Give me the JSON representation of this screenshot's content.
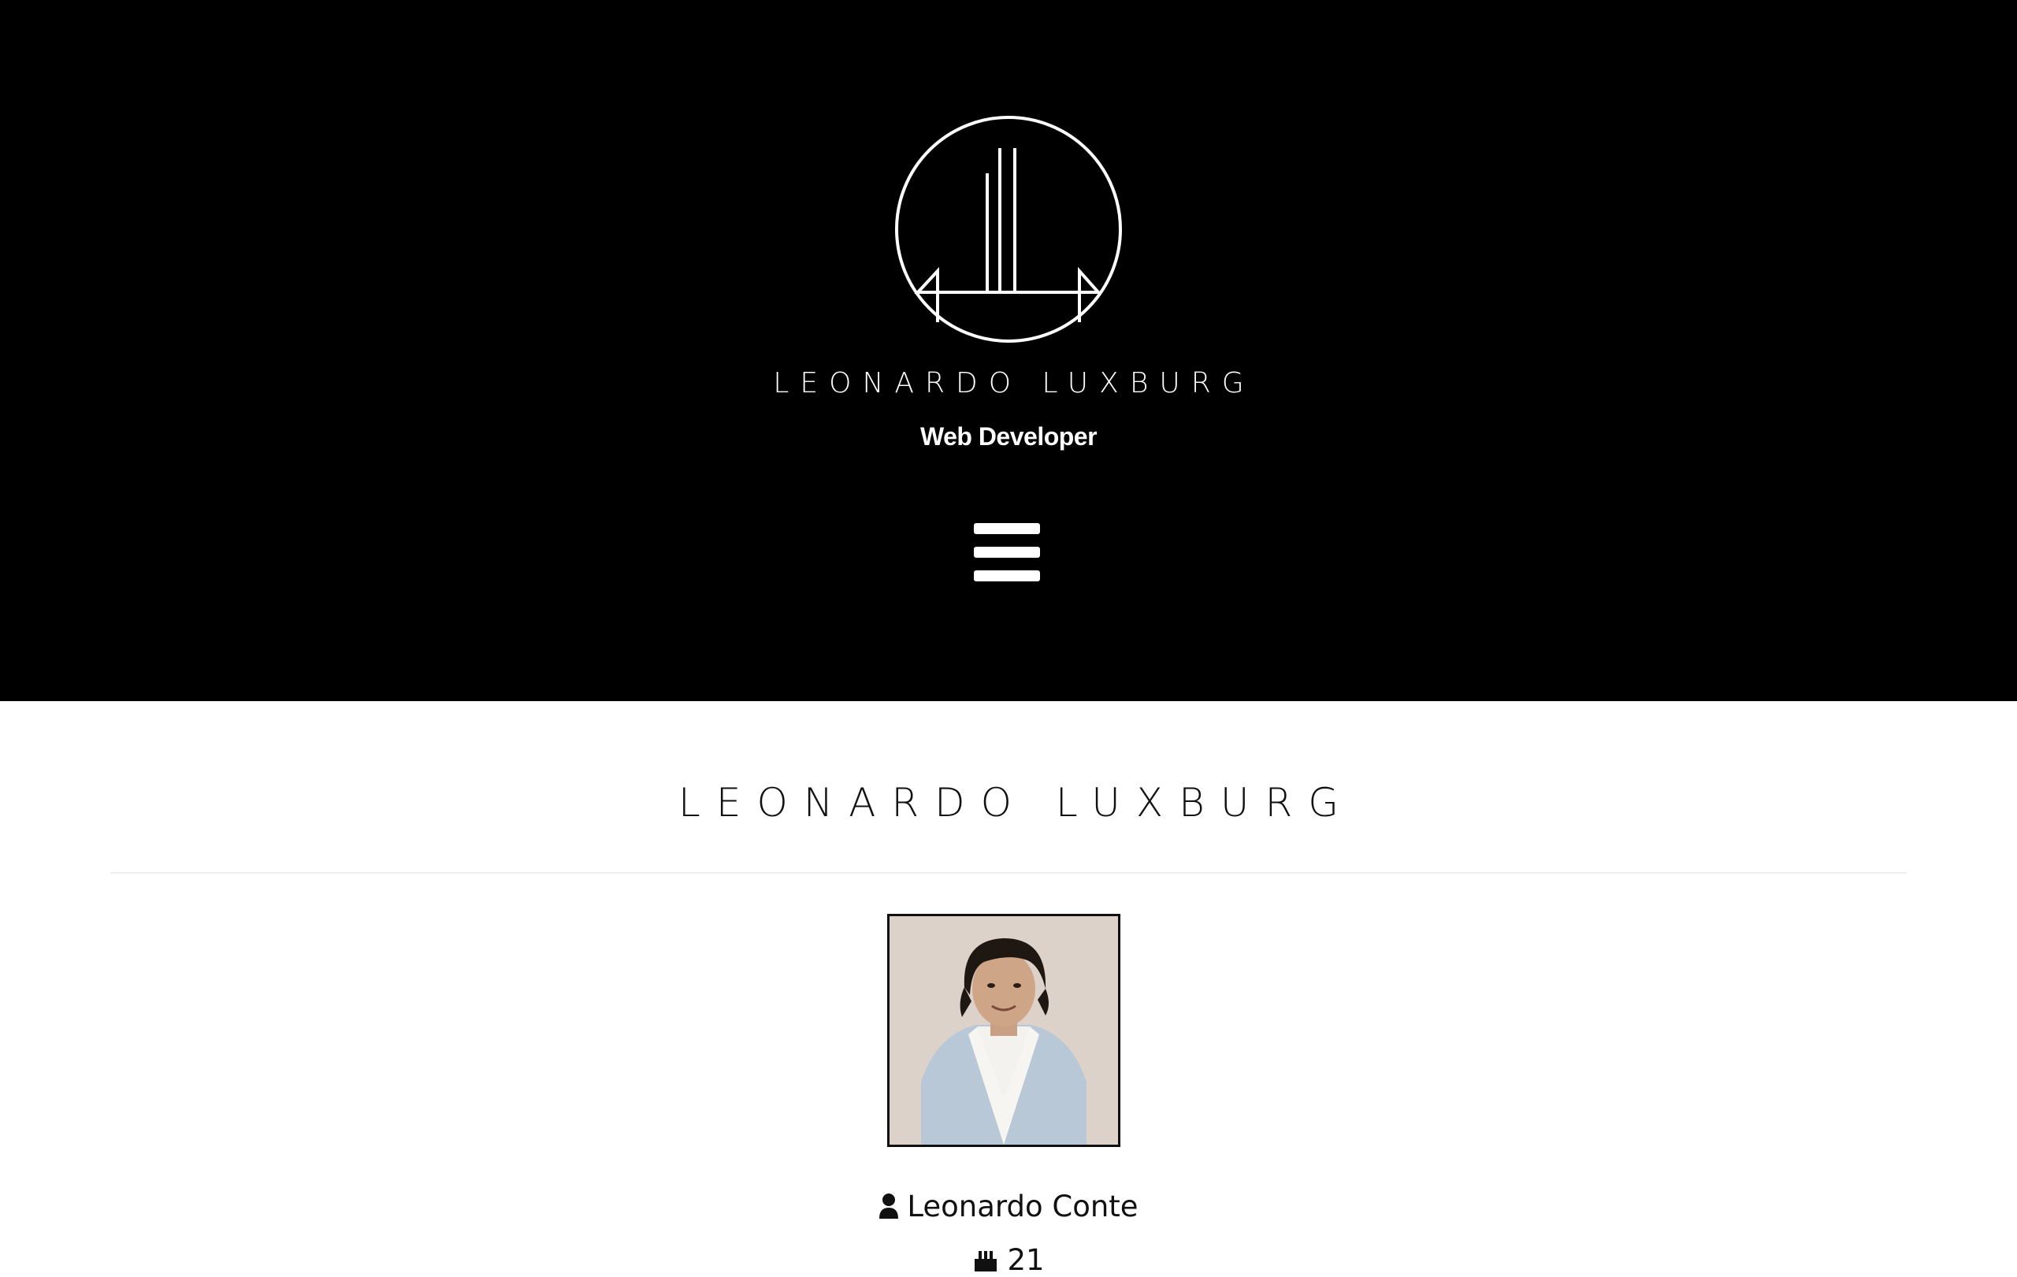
{
  "header": {
    "brand": "LEONARDO LUXBURG",
    "role": "Web Developer",
    "menu_icon": "hamburger-menu-icon"
  },
  "about": {
    "title": "LEONARDO LUXBURG",
    "portrait_icon": "portrait-photo",
    "name_icon": "user-icon",
    "name": "Leonardo Conte",
    "age_icon": "birthday-cake-icon",
    "age": "21"
  },
  "colors": {
    "hero_background": "#000000",
    "page_background": "#ffffff",
    "text": "#111111",
    "divider": "#eeeeee"
  }
}
